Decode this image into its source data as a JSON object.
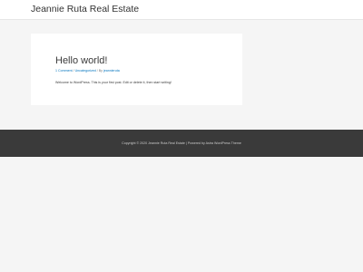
{
  "header": {
    "site_title": "Jeannie Ruta Real Estate"
  },
  "post": {
    "title": "Hello world!",
    "meta": {
      "comments": "1 Comment",
      "separator": " / ",
      "category": "Uncategorized",
      "by": " / By ",
      "author": "jeannieruta"
    },
    "excerpt": "Welcome to WordPress. This is your first post. Edit or delete it, then start writing!"
  },
  "footer": {
    "text": "Copyright © 2020 Jeannie Ruta Real Estate | Powered by Astra WordPress Theme"
  },
  "colors": {
    "background": "#f5f5f5",
    "card": "#ffffff",
    "link": "#0274be",
    "footer_bg": "#3a3a3a"
  }
}
